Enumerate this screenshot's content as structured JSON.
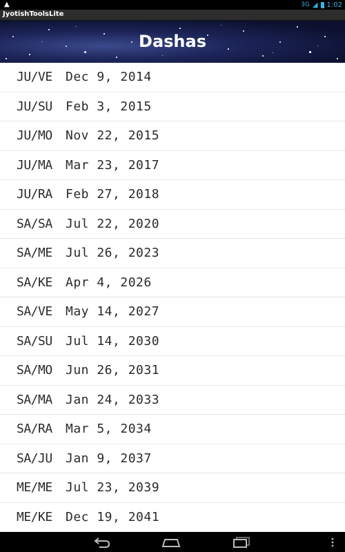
{
  "status_bar": {
    "notification_icon": "warning-icon",
    "signal_label": "3G",
    "time": "1:02"
  },
  "app": {
    "name": "JyotishToolsLite"
  },
  "header": {
    "title": "Dashas"
  },
  "dashas": [
    {
      "period": "JU/VE",
      "date": "Dec 9, 2014"
    },
    {
      "period": "JU/SU",
      "date": "Feb 3, 2015"
    },
    {
      "period": "JU/MO",
      "date": "Nov 22, 2015"
    },
    {
      "period": "JU/MA",
      "date": "Mar 23, 2017"
    },
    {
      "period": "JU/RA",
      "date": "Feb 27, 2018"
    },
    {
      "period": "SA/SA",
      "date": "Jul 22, 2020"
    },
    {
      "period": "SA/ME",
      "date": "Jul 26, 2023"
    },
    {
      "period": "SA/KE",
      "date": "Apr 4, 2026"
    },
    {
      "period": "SA/VE",
      "date": "May 14, 2027"
    },
    {
      "period": "SA/SU",
      "date": "Jul 14, 2030"
    },
    {
      "period": "SA/MO",
      "date": "Jun 26, 2031"
    },
    {
      "period": "SA/MA",
      "date": "Jan 24, 2033"
    },
    {
      "period": "SA/RA",
      "date": "Mar 5, 2034"
    },
    {
      "period": "SA/JU",
      "date": "Jan 9, 2037"
    },
    {
      "period": "ME/ME",
      "date": "Jul 23, 2039"
    },
    {
      "period": "ME/KE",
      "date": "Dec 19, 2041"
    }
  ],
  "nav_bar": {
    "back_icon": "back-icon",
    "home_icon": "home-icon",
    "recent_icon": "recent-apps-icon",
    "menu_icon": "overflow-menu-icon"
  },
  "colors": {
    "status_accent": "#33b5e5",
    "header_dark": "#0c1130",
    "list_bg": "#ffffff",
    "text": "#2a2a2a"
  }
}
